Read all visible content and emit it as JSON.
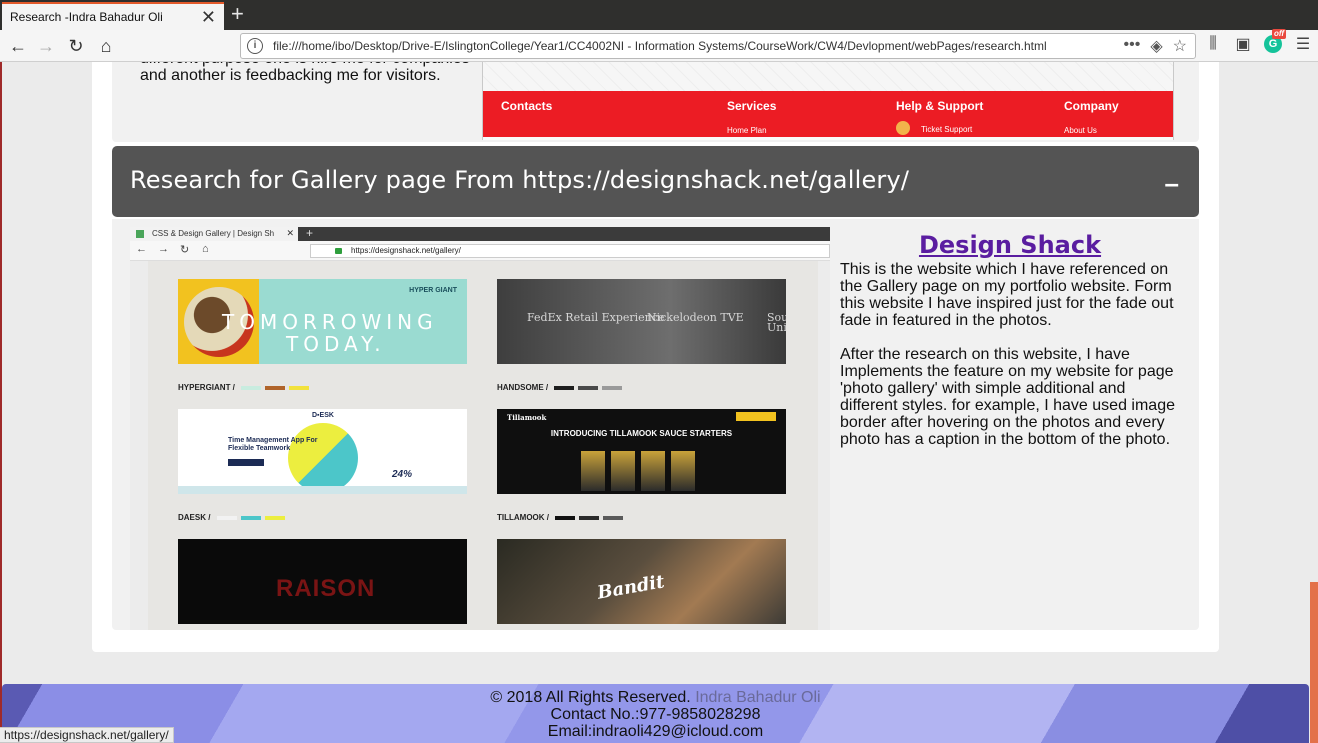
{
  "browser": {
    "tab_title": "Research -Indra Bahadur Oli",
    "tab_close": "✕",
    "new_tab": "+",
    "url": "file:///home/ibo/Desktop/Drive-E/IslingtonCollege/Year1/CC4002NI - Information Systems/CourseWork/CW4/Devlopment/webPages/research.html",
    "extension_badge": "off",
    "status_link": "https://designshack.net/gallery/"
  },
  "prev_section": {
    "text": "different purpose one is hire me for companies and another is feedbacking me for visitors.",
    "shot": {
      "columns": [
        "Contacts",
        "Services",
        "Help & Support",
        "Company"
      ],
      "subitems": [
        "Home Plan",
        "Ticket Support",
        "About Us"
      ]
    }
  },
  "gallery_section": {
    "heading": "Research for Gallery page From https://designshack.net/gallery/",
    "toggle": "–",
    "shot": {
      "tab_title": "CSS & Design Gallery | Design Sh",
      "tab_close": "✕",
      "new_tab": "+",
      "url": "https://designshack.net/gallery/",
      "thumbs": [
        {
          "label": "HYPERGIANT /",
          "swatches": [
            "#c8ecdf",
            "#b0642a",
            "#f2e23c"
          ]
        },
        {
          "label": "HANDSOME /",
          "swatches": [
            "#1e1e1e",
            "#4a4a4a",
            "#9a9a9a"
          ]
        },
        {
          "label": "DAESK /",
          "swatches": [
            "#f2f2f2",
            "#4cc6c9",
            "#ecee3f"
          ]
        },
        {
          "label": "TILLAMOOK /",
          "swatches": [
            "#111111",
            "#2b2b2b",
            "#5a5a5a"
          ]
        }
      ],
      "hypergiant": {
        "line1": "TOMORROWING",
        "line2": "TODAY.",
        "brand": "HYPER GIANT"
      },
      "handsome": {
        "t1": "FedEx Retail Experience",
        "t2": "Nickelodeon TVE",
        "t3": "Sou Uni"
      },
      "daesk": {
        "logo": "D▪ESK",
        "headline": "Time Management App For Flexible Teamwork",
        "number": "24%"
      },
      "tillamook": {
        "brand": "Tillamook",
        "headline": "INTRODUCING TILLAMOOK SAUCE STARTERS"
      },
      "raison": {
        "word": "RAISON"
      },
      "bandit": {
        "word": "Bandit"
      }
    },
    "description": {
      "title": "Design Shack",
      "p1": "This is the website which I have referenced on the Gallery page on my portfolio website. Form this website I have inspired just for the fade out fade in featured in the photos.",
      "p2": "After the research on this website, I have Implements the feature on my website for page 'photo gallery' with simple additional and different styles. for example, I have used image border after hovering on the photos and every photo has a caption in the bottom of the photo."
    }
  },
  "footer": {
    "copyright": "© 2018 All Rights Reserved.",
    "name": "Indra Bahadur Oli",
    "contact": "Contact No.:977-9858028298",
    "email": "Email:indraoli429@icloud.com"
  }
}
